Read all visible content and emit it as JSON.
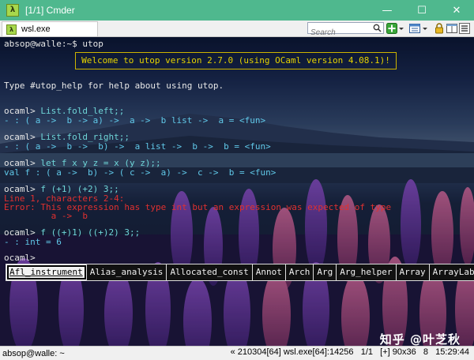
{
  "window": {
    "title": "[1/1] Cmder",
    "minimize": "—",
    "maximize": "☐",
    "close": "✕",
    "app_icon": "λ"
  },
  "tab": {
    "label": "wsl.exe",
    "icon": "λ"
  },
  "search": {
    "placeholder": "Search"
  },
  "terminal": {
    "lines": [
      {
        "prompt": "absop@walle:~$ ",
        "code": "utop"
      },
      {
        "text": "Type #utop_help for help about using utop."
      },
      {
        "prompt": "ocaml> ",
        "code": "List.fold_left;;"
      },
      {
        "type": "- : ( a ->  b -> a) ->  a ->  b list ->  a = <fun>"
      },
      {
        "prompt": "ocaml> ",
        "code": "List.fold_right;;"
      },
      {
        "type": "- : ( a ->  b ->  b) ->  a list ->  b ->  b = <fun>"
      },
      {
        "prompt": "ocaml> ",
        "code": "let f x y z = x (y z);;"
      },
      {
        "type": "val f : ( a ->  b) -> ( c ->  a) ->  c ->  b = <fun>"
      },
      {
        "prompt": "ocaml> ",
        "code": "f (+1) (+2) 3;;"
      },
      {
        "err": "Line 1, characters 2-4:"
      },
      {
        "err": "Error: This expression has type int but an expression was expected of type"
      },
      {
        "err": "         a ->  b"
      },
      {
        "prompt": "ocaml> ",
        "code": "f ((+)1) ((+)2) 3;;"
      },
      {
        "type": "- : int = 6"
      },
      {
        "prompt": "ocaml> ",
        "code": ""
      }
    ],
    "welcome": "Welcome to utop version 2.7.0 (using OCaml version 4.08.1)!",
    "completions": [
      "Afl_instrument",
      "Alias_analysis",
      "Allocated_const",
      "Annot",
      "Arch",
      "Arg",
      "Arg_helper",
      "Array",
      "ArrayLabel"
    ]
  },
  "watermark": "知乎 @叶芝秋",
  "status": {
    "left": "absop@walle: ~",
    "right": "« 210304[64] wsl.exe[64]:14256   1/1   [+] 90x36   8   15:29:44"
  }
}
